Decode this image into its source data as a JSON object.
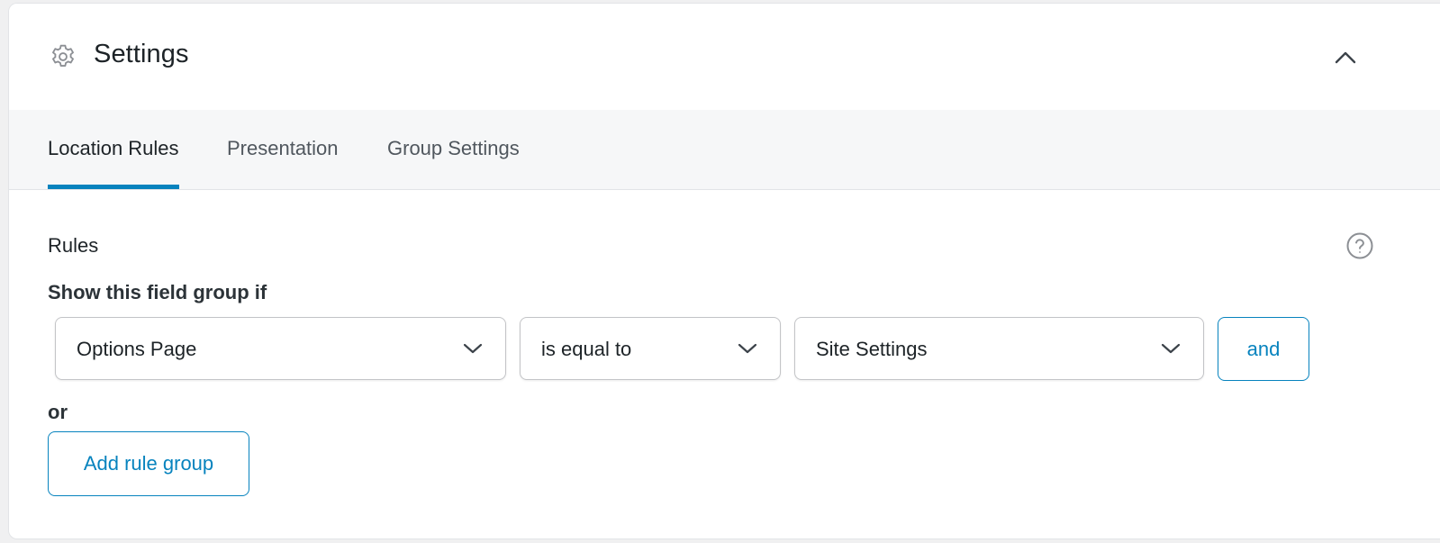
{
  "header": {
    "title": "Settings",
    "icon": "gear-icon",
    "collapse_icon": "chevron-up-icon"
  },
  "tabs": [
    {
      "label": "Location Rules",
      "active": true
    },
    {
      "label": "Presentation",
      "active": false
    },
    {
      "label": "Group Settings",
      "active": false
    }
  ],
  "rules": {
    "section_label": "Rules",
    "help_icon": "help-circle-icon",
    "condition_label": "Show this field group if",
    "rule": {
      "param": "Options Page",
      "operator": "is equal to",
      "value": "Site Settings",
      "and_label": "and"
    },
    "or_label": "or",
    "add_group_label": "Add rule group"
  },
  "colors": {
    "accent": "#0783be",
    "text": "#1d2327",
    "muted": "#50575e",
    "border": "#c3c4c7",
    "tab_bar_bg": "#f6f7f8"
  }
}
